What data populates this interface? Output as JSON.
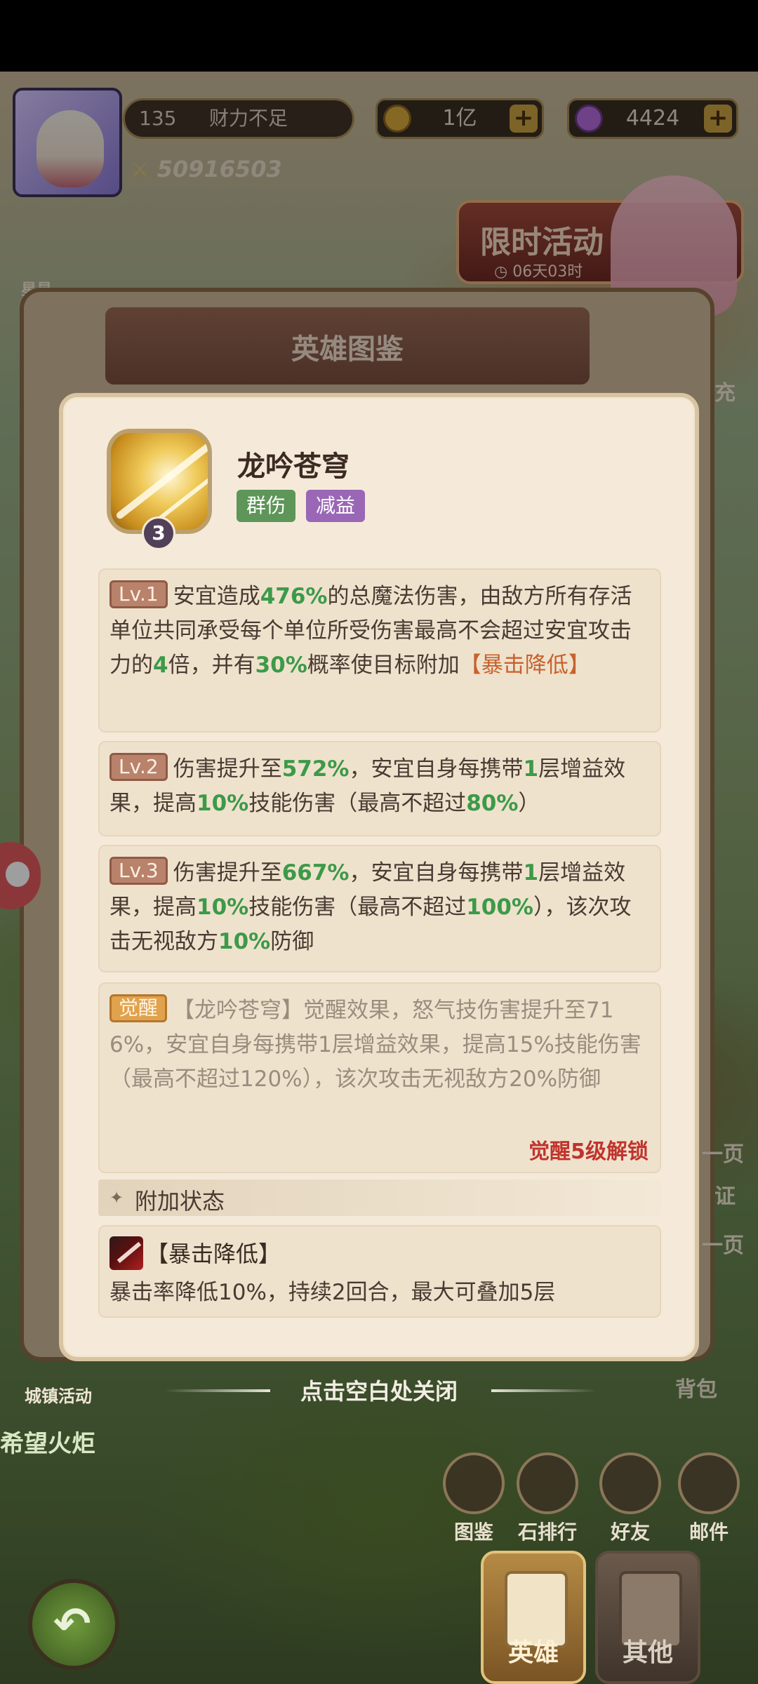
{
  "player": {
    "level": "135",
    "level_label": "财力不足",
    "combat_power": "50916503"
  },
  "resources": {
    "gold": "1亿",
    "gems": "4424",
    "plus": "+"
  },
  "event": {
    "title": "限时活动",
    "timer": "06天03时"
  },
  "book": {
    "title": "英雄图鉴"
  },
  "side_labels": {
    "left_top": "星易",
    "right_top": "充",
    "right_page_a": "一页",
    "right_zheng": "证",
    "right_page_b": "一页",
    "right_bag": "背包"
  },
  "skill": {
    "name": "龙吟苍穹",
    "level_badge": "3",
    "tags": [
      "群伤",
      "减益"
    ],
    "levels": [
      {
        "tag": "Lv.1",
        "segments": [
          "安宜造成",
          "476%",
          "的总魔法伤害，由敌方所有存活单位共同承受每个单位所受伤害最高不会超过安宜攻击力的",
          "4",
          "倍，并有",
          "30%",
          "概率使目标附加",
          "【暴击降低】"
        ]
      },
      {
        "tag": "Lv.2",
        "segments": [
          "伤害提升至",
          "572%",
          "，安宜自身每携带",
          "1",
          "层增益效果，提高",
          "10%",
          "技能伤害（最高不超过",
          "80%",
          "）"
        ]
      },
      {
        "tag": "Lv.3",
        "segments": [
          "伤害提升至",
          "667%",
          "，安宜自身每携带",
          "1",
          "层增益效果，提高",
          "10%",
          "技能伤害（最高不超过",
          "100%",
          "），该次攻击无视敌方",
          "10%",
          "防御"
        ]
      }
    ],
    "awaken": {
      "tag": "觉醒",
      "text": "【龙吟苍穹】觉醒效果，怒气技伤害提升至716%，安宜自身每携带1层增益效果，提高15%技能伤害（最高不超过120%），该次攻击无视敌方20%防御",
      "unlock": "觉醒5级解锁"
    },
    "status_section_title": "附加状态",
    "status": {
      "name": "【暴击降低】",
      "desc": "暴击率降低10%，持续2回合，最大可叠加5层"
    }
  },
  "hint": "点击空白处关闭",
  "bottom_bar": {
    "left_event": "城镇活动",
    "left_banner": "希望火炬",
    "icons": [
      "图鉴",
      "石排行",
      "好友",
      "邮件"
    ],
    "tabs": [
      "英雄",
      "其他"
    ]
  },
  "colors": {
    "value_green": "#3c9a48",
    "debuff_orange": "#c8612c",
    "unlock_red": "#c0342e",
    "tag_green": "#5d9658",
    "tag_purple": "#9a67b6"
  }
}
